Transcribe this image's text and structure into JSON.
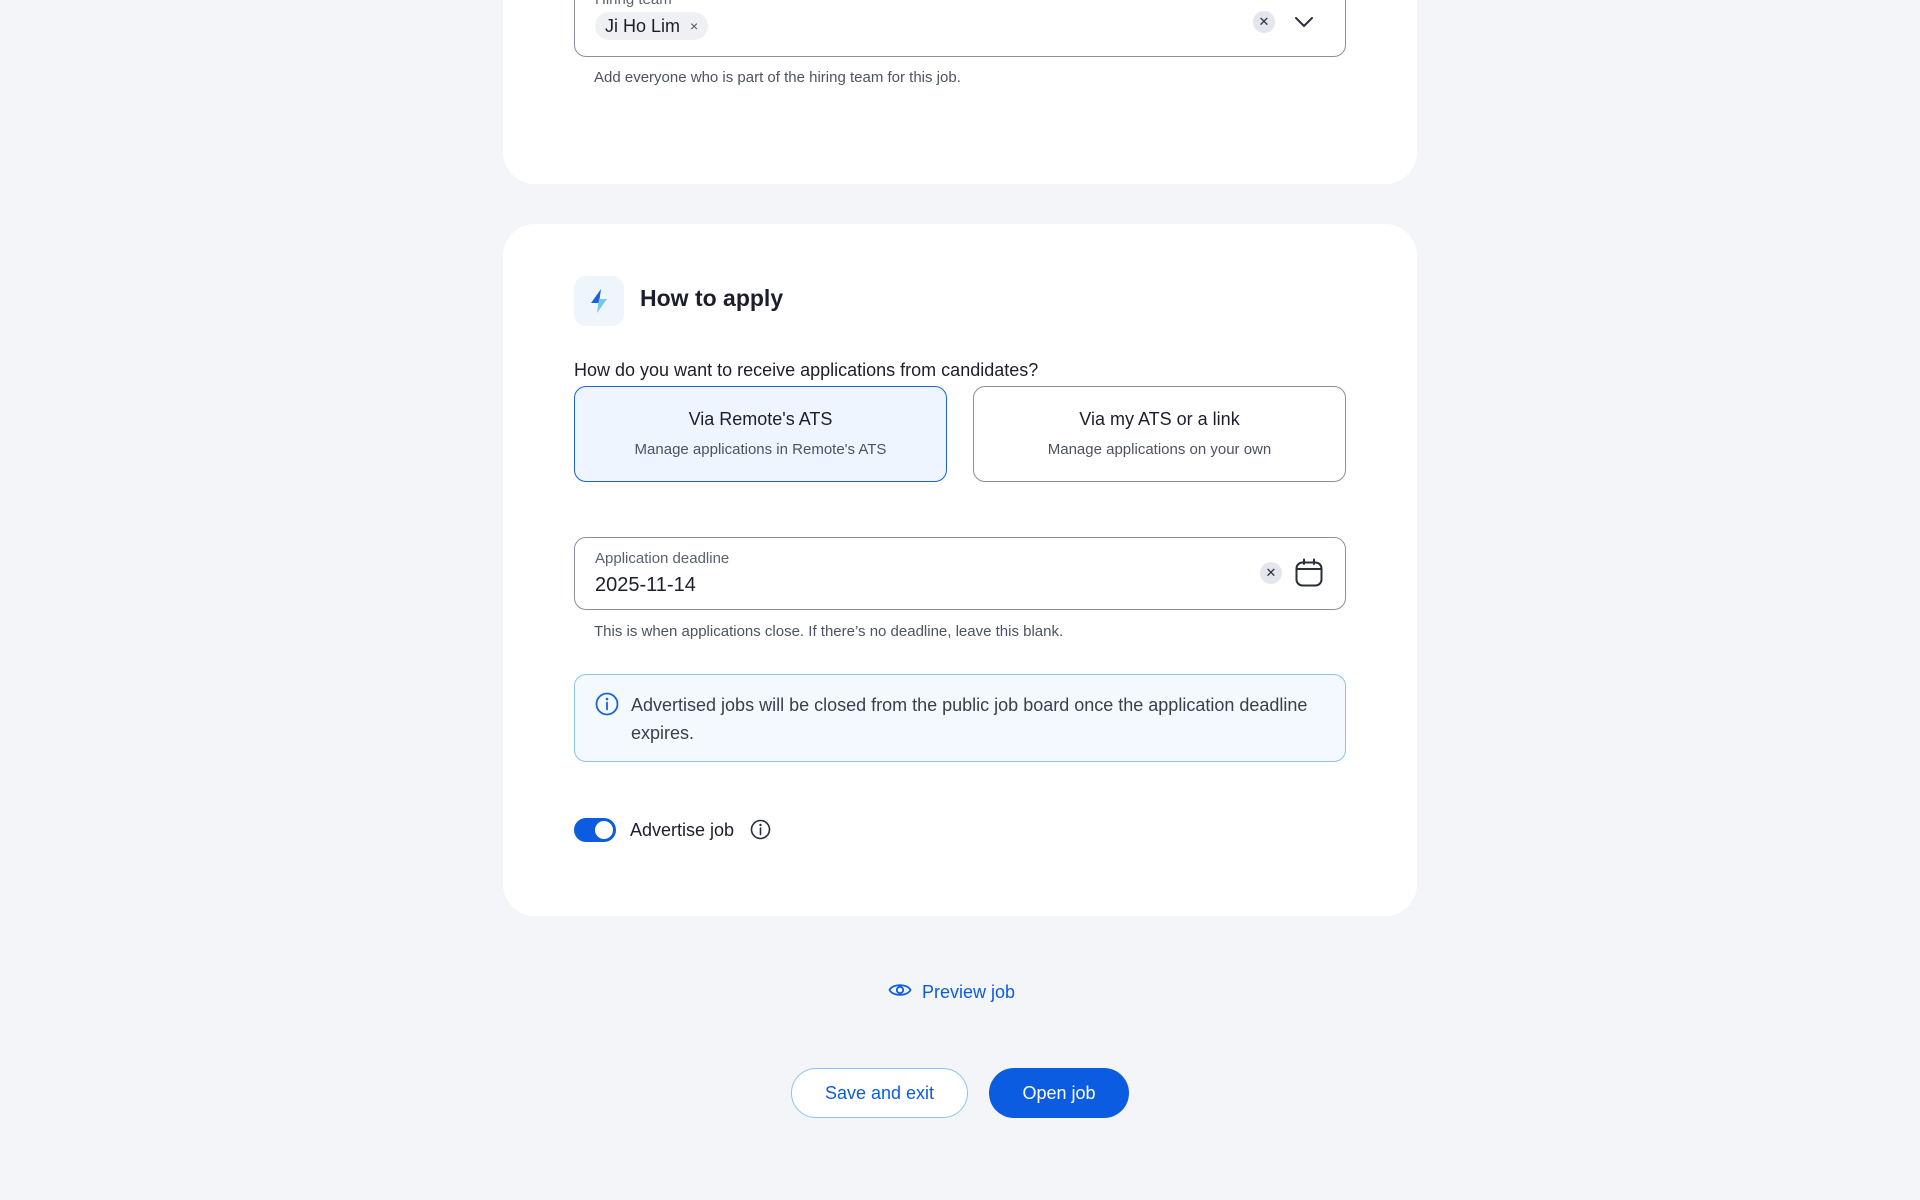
{
  "hiring_team": {
    "label": "Hiring team",
    "members": [
      {
        "name": "Ji Ho Lim",
        "remove_glyph": "×"
      }
    ],
    "helper": "Add everyone who is part of the hiring team for this job.",
    "clear_glyph": "✕",
    "icons": {
      "clear": "close-icon",
      "expand": "chevron-down-icon"
    }
  },
  "how_to_apply": {
    "title": "How to apply",
    "icon": "lightning-icon",
    "question": "How do you want to receive applications from candidates?",
    "options": [
      {
        "title": "Via Remote's ATS",
        "subtitle": "Manage applications in Remote's ATS",
        "selected": true
      },
      {
        "title": "Via my ATS or a link",
        "subtitle": "Manage applications on your own",
        "selected": false
      }
    ],
    "deadline": {
      "label": "Application deadline",
      "value": "2025-11-14",
      "helper": "This is when applications close. If there’s no deadline, leave this blank.",
      "clear_glyph": "✕",
      "icons": {
        "clear": "close-icon",
        "calendar": "calendar-icon"
      }
    },
    "alert": {
      "icon": "info-icon",
      "text": "Advertised jobs will be closed from the public job board once the application deadline expires."
    },
    "advertise": {
      "label": "Advertise job",
      "enabled": true,
      "icon": "info-icon"
    }
  },
  "actions": {
    "preview_label": "Preview job",
    "preview_icon": "eye-icon",
    "save_exit_label": "Save and exit",
    "open_job_label": "Open job"
  },
  "colors": {
    "accent": "#0b5ce1",
    "page_bg": "#f3f5f9",
    "card_bg": "#ffffff",
    "info_border": "#8cc4ee",
    "info_bg": "#f3f9fe"
  }
}
